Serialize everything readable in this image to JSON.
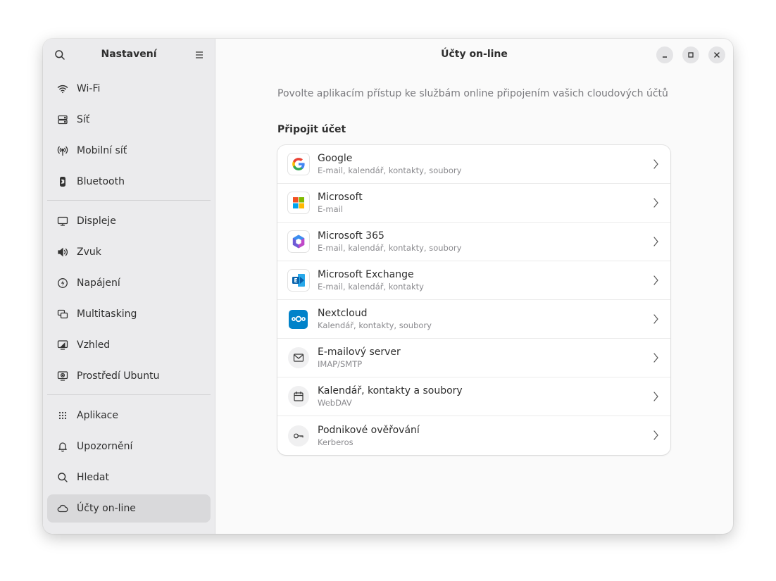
{
  "sidebar": {
    "title": "Nastavení",
    "items": [
      {
        "label": "Wi-Fi",
        "icon": "wifi-icon"
      },
      {
        "label": "Síť",
        "icon": "network-icon"
      },
      {
        "label": "Mobilní síť",
        "icon": "mobile-network-icon"
      },
      {
        "label": "Bluetooth",
        "icon": "bluetooth-icon"
      },
      {
        "label": "Displeje",
        "icon": "display-icon"
      },
      {
        "label": "Zvuk",
        "icon": "speaker-icon"
      },
      {
        "label": "Napájení",
        "icon": "power-icon"
      },
      {
        "label": "Multitasking",
        "icon": "multitasking-icon"
      },
      {
        "label": "Vzhled",
        "icon": "appearance-icon"
      },
      {
        "label": "Prostředí Ubuntu",
        "icon": "ubuntu-desktop-icon"
      },
      {
        "label": "Aplikace",
        "icon": "apps-grid-icon"
      },
      {
        "label": "Upozornění",
        "icon": "bell-icon"
      },
      {
        "label": "Hledat",
        "icon": "search-icon"
      },
      {
        "label": "Účty on-line",
        "icon": "cloud-icon"
      }
    ],
    "active_index": 13
  },
  "main": {
    "title": "Účty on-line",
    "description": "Povolte aplikacím přístup ke službám online připojením vašich cloudových účtů",
    "section_title": "Připojit účet",
    "providers": [
      {
        "name": "Google",
        "detail": "E-mail, kalendář, kontakty, soubory",
        "icon": "google-icon"
      },
      {
        "name": "Microsoft",
        "detail": "E-mail",
        "icon": "microsoft-icon"
      },
      {
        "name": "Microsoft 365",
        "detail": "E-mail, kalendář, kontakty, soubory",
        "icon": "microsoft-365-icon"
      },
      {
        "name": "Microsoft Exchange",
        "detail": "E-mail, kalendář, kontakty",
        "icon": "exchange-icon"
      },
      {
        "name": "Nextcloud",
        "detail": "Kalendář, kontakty, soubory",
        "icon": "nextcloud-icon"
      },
      {
        "name": "E-mailový server",
        "detail": "IMAP/SMTP",
        "icon": "envelope-icon"
      },
      {
        "name": "Kalendář, kontakty a soubory",
        "detail": "WebDAV",
        "icon": "calendar-icon"
      },
      {
        "name": "Podnikové ověřování",
        "detail": "Kerberos",
        "icon": "key-icon"
      }
    ]
  },
  "colors": {
    "sidebar_bg": "#ebebed",
    "sidebar_active": "#d9d9db",
    "content_bg": "#fafafa",
    "card_bg": "#ffffff",
    "text": "#2e2e2e",
    "muted_text": "#7a7a7e"
  }
}
